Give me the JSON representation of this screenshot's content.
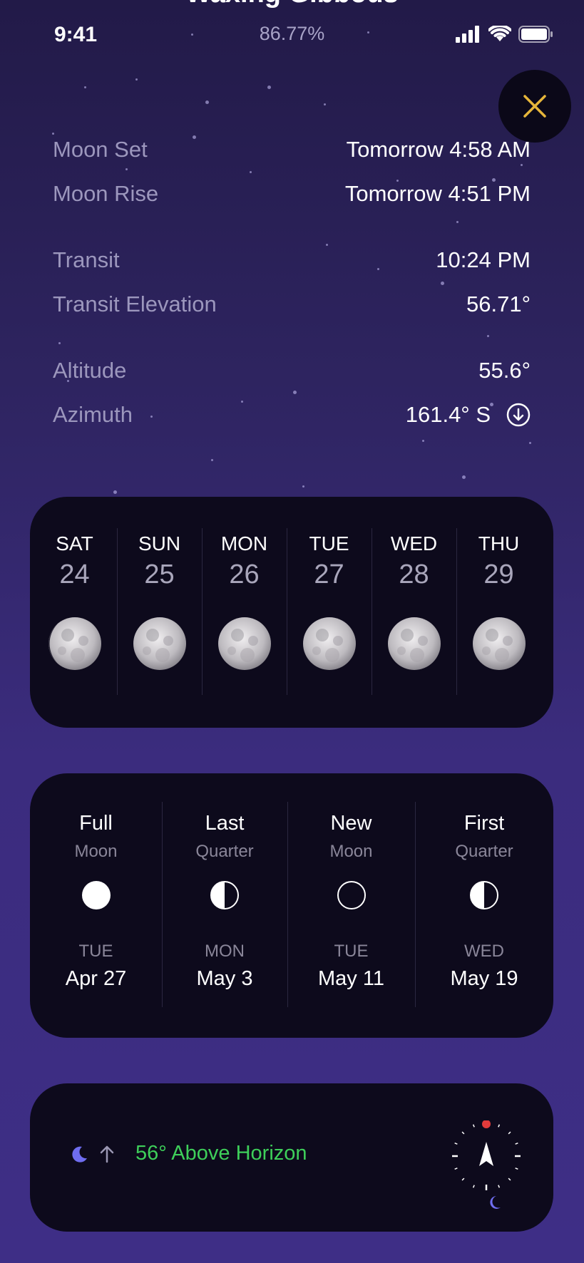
{
  "header": {
    "title": "Waxing Gibbous"
  },
  "status_bar": {
    "time": "9:41",
    "illumination": "86.77%",
    "icons": [
      "signal-icon",
      "wifi-icon",
      "battery-icon"
    ]
  },
  "close_button": {
    "icon": "close-icon",
    "color": "#e6b53a"
  },
  "details": {
    "moon_set": {
      "label": "Moon Set",
      "value": "Tomorrow 4:58 AM"
    },
    "moon_rise": {
      "label": "Moon Rise",
      "value": "Tomorrow 4:51 PM"
    },
    "transit": {
      "label": "Transit",
      "value": "10:24 PM"
    },
    "transit_elevation": {
      "label": "Transit Elevation",
      "value": "56.71°"
    },
    "altitude": {
      "label": "Altitude",
      "value": "55.6°"
    },
    "azimuth": {
      "label": "Azimuth",
      "value": "161.4° S",
      "icon": "arrow-down-circle-icon"
    }
  },
  "forecast": [
    {
      "day": "SAT",
      "date": "24"
    },
    {
      "day": "SUN",
      "date": "25"
    },
    {
      "day": "MON",
      "date": "26"
    },
    {
      "day": "TUE",
      "date": "27"
    },
    {
      "day": "WED",
      "date": "28"
    },
    {
      "day": "THU",
      "date": "29"
    }
  ],
  "phases": [
    {
      "title": "Full",
      "subtitle": "Moon",
      "day": "TUE",
      "date": "Apr 27",
      "icon": "full-moon-icon"
    },
    {
      "title": "Last",
      "subtitle": "Quarter",
      "day": "MON",
      "date": "May 3",
      "icon": "last-quarter-icon"
    },
    {
      "title": "New",
      "subtitle": "Moon",
      "day": "TUE",
      "date": "May 11",
      "icon": "new-moon-icon"
    },
    {
      "title": "First",
      "subtitle": "Quarter",
      "day": "WED",
      "date": "May 19",
      "icon": "first-quarter-icon"
    }
  ],
  "horizon": {
    "text": "56° Above Horizon",
    "color": "#3ecf5a",
    "icons": [
      "crescent-moon-icon",
      "arrow-up-icon"
    ]
  },
  "compass": {
    "icon": "compass-icon",
    "north_color": "#e23b3b",
    "moon_color": "#7a73ff"
  }
}
